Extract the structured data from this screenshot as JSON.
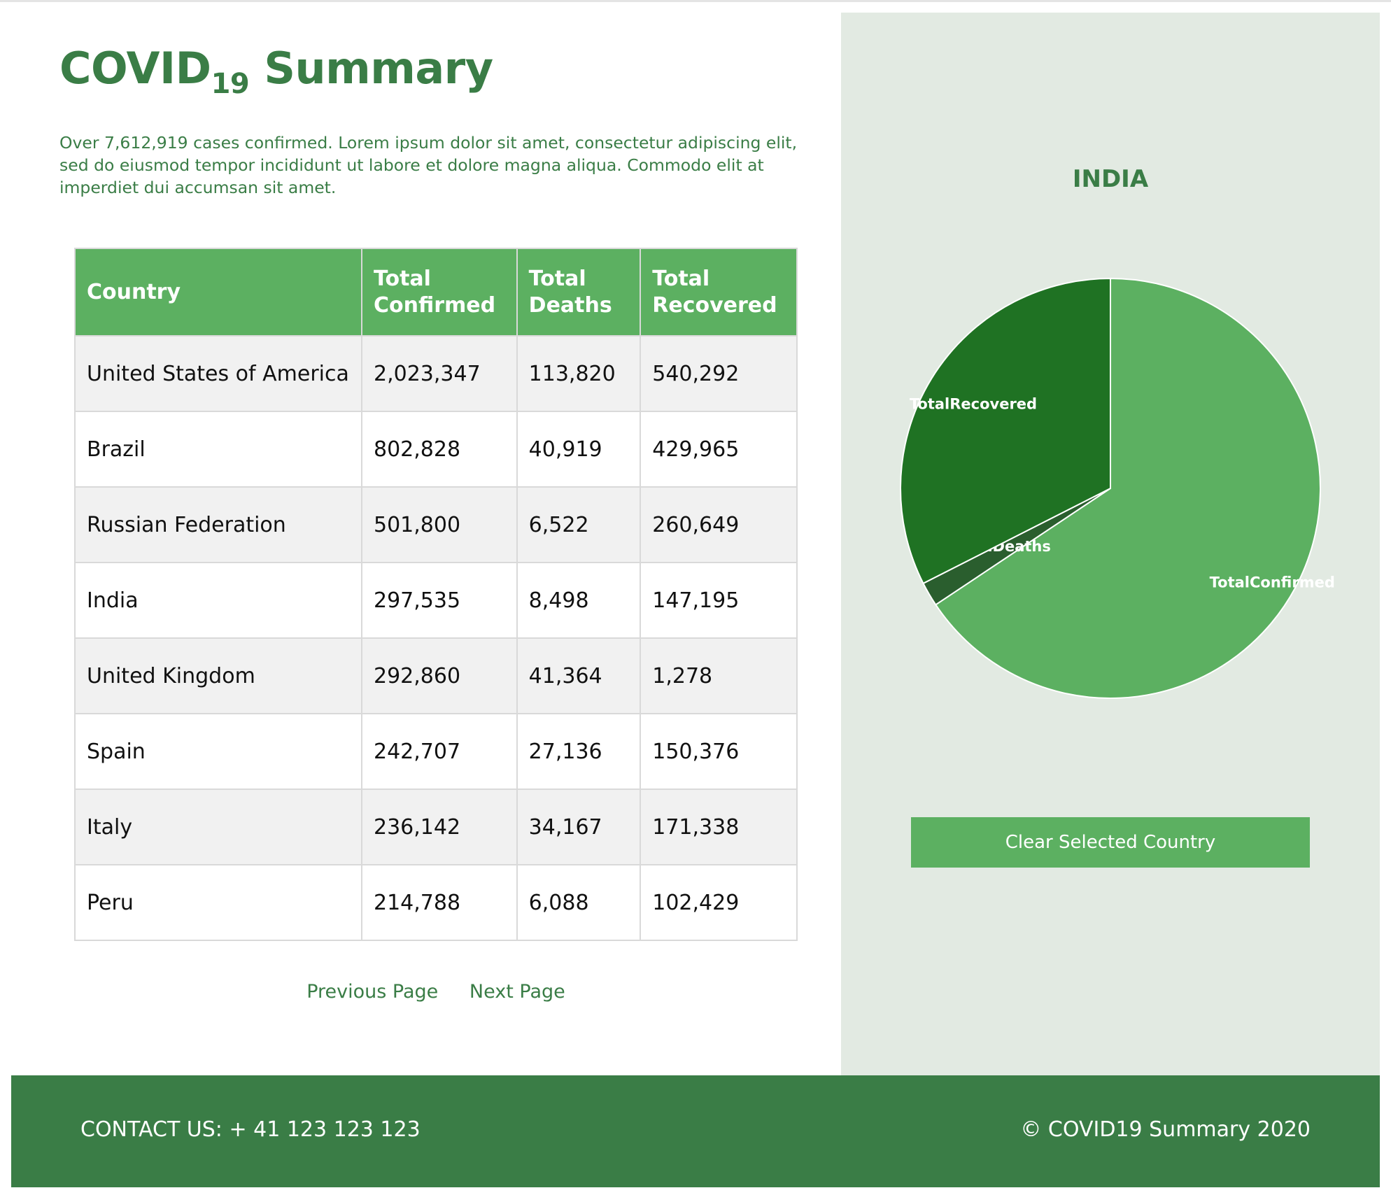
{
  "header": {
    "title_main": "COVID",
    "title_sub": "19",
    "title_rest": " Summary",
    "intro": "Over 7,612,919 cases confirmed. Lorem ipsum dolor sit amet, consectetur adipiscing elit, sed do eiusmod tempor incididunt ut labore et dolore magna aliqua. Commodo elit at imperdiet dui accumsan sit amet."
  },
  "table": {
    "headers": {
      "country": "Country",
      "confirmed_1": "Total",
      "confirmed_2": "Confirmed",
      "deaths_1": "Total",
      "deaths_2": "Deaths",
      "recovered_1": "Total",
      "recovered_2": "Recovered"
    },
    "rows": [
      {
        "country": "United States of America",
        "confirmed": "2,023,347",
        "deaths": "113,820",
        "recovered": "540,292"
      },
      {
        "country": "Brazil",
        "confirmed": "802,828",
        "deaths": "40,919",
        "recovered": "429,965"
      },
      {
        "country": "Russian Federation",
        "confirmed": "501,800",
        "deaths": "6,522",
        "recovered": "260,649"
      },
      {
        "country": "India",
        "confirmed": "297,535",
        "deaths": "8,498",
        "recovered": "147,195"
      },
      {
        "country": "United Kingdom",
        "confirmed": "292,860",
        "deaths": "41,364",
        "recovered": "1,278"
      },
      {
        "country": "Spain",
        "confirmed": "242,707",
        "deaths": "27,136",
        "recovered": "150,376"
      },
      {
        "country": "Italy",
        "confirmed": "236,142",
        "deaths": "34,167",
        "recovered": "171,338"
      },
      {
        "country": "Peru",
        "confirmed": "214,788",
        "deaths": "6,088",
        "recovered": "102,429"
      }
    ]
  },
  "pager": {
    "previous": "Previous Page",
    "next": "Next Page"
  },
  "sidebar": {
    "selected_country": "INDIA",
    "clear_button": "Clear Selected Country"
  },
  "chart_data": {
    "type": "pie",
    "categories": [
      "TotalConfirmed",
      "TotalDeaths",
      "TotalRecovered"
    ],
    "labels_shown": [
      "TotalConfirmed",
      "talDeaths",
      "TotalRecovered"
    ],
    "values": [
      297535,
      8498,
      147195
    ],
    "colors": [
      "#5cb061",
      "#2a5e2e",
      "#1f7223"
    ]
  },
  "footer": {
    "contact": "CONTACT US: + 41 123 123 123",
    "copyright": "© COVID19 Summary 2020"
  },
  "theme": {
    "primary": "#3a7d46",
    "accent": "#5cb061",
    "sidebar_bg": "#e2eae2"
  }
}
